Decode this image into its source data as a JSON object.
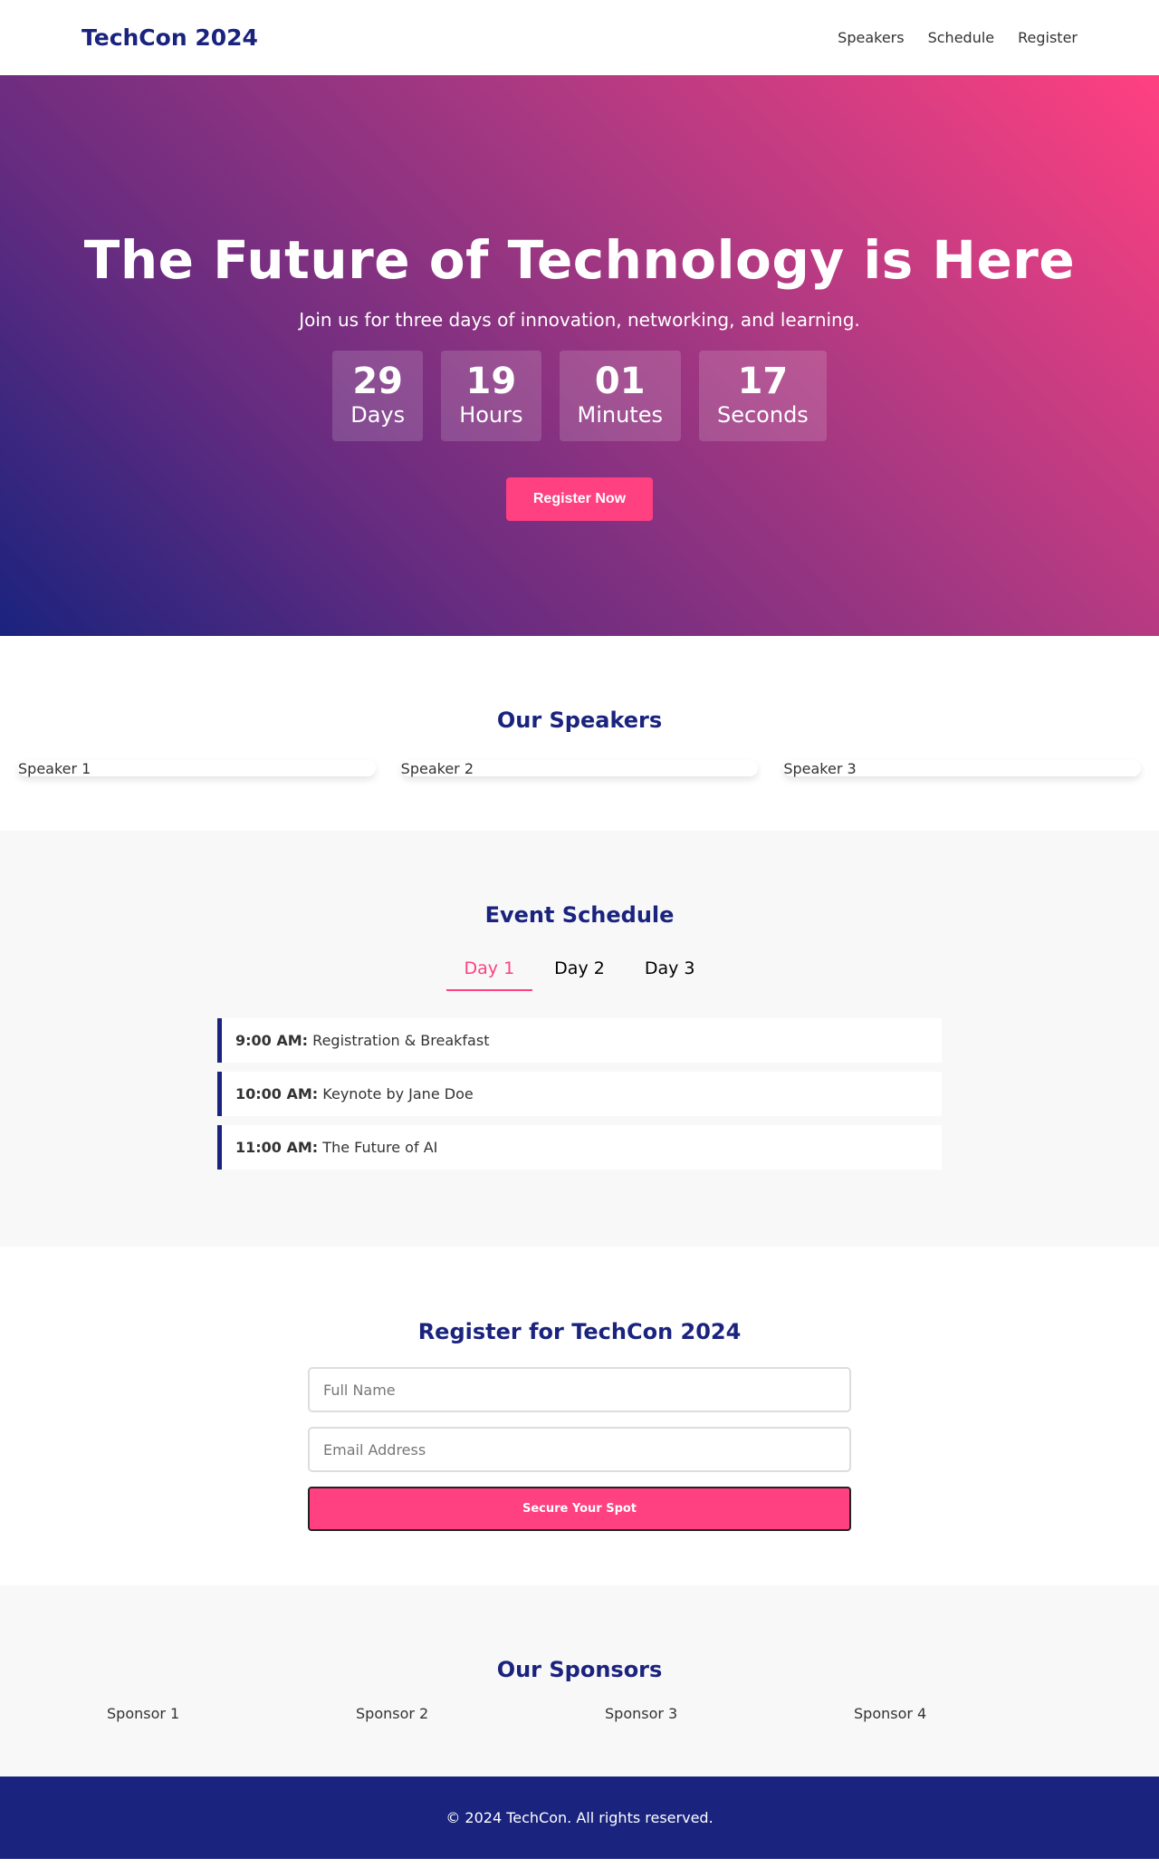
{
  "header": {
    "logo": "TechCon 2024",
    "nav": [
      "Speakers",
      "Schedule",
      "Register"
    ]
  },
  "hero": {
    "title": "The Future of Technology is Here",
    "subtitle": "Join us for three days of innovation, networking, and learning.",
    "countdown": [
      {
        "value": "29",
        "label": "Days"
      },
      {
        "value": "19",
        "label": "Hours"
      },
      {
        "value": "01",
        "label": "Minutes"
      },
      {
        "value": "17",
        "label": "Seconds"
      }
    ],
    "cta": "Register Now"
  },
  "speakers": {
    "title": "Our Speakers",
    "items": [
      "Speaker 1",
      "Speaker 2",
      "Speaker 3"
    ]
  },
  "schedule": {
    "title": "Event Schedule",
    "tabs": [
      "Day 1",
      "Day 2",
      "Day 3"
    ],
    "active_tab": "Day 1",
    "items": [
      {
        "time": "9:00 AM:",
        "event": "Registration & Breakfast"
      },
      {
        "time": "10:00 AM:",
        "event": "Keynote by Jane Doe"
      },
      {
        "time": "11:00 AM:",
        "event": "The Future of AI"
      }
    ]
  },
  "register": {
    "title": "Register for TechCon 2024",
    "name_placeholder": "Full Name",
    "email_placeholder": "Email Address",
    "submit": "Secure Your Spot"
  },
  "sponsors": {
    "title": "Our Sponsors",
    "items": [
      "Sponsor 1",
      "Sponsor 2",
      "Sponsor 3",
      "Sponsor 4"
    ]
  },
  "footer": {
    "text": "© 2024 TechCon. All rights reserved."
  },
  "colors": {
    "brand": "#1a237e",
    "accent": "#ff4081",
    "section_bg": "#f8f8f8"
  }
}
